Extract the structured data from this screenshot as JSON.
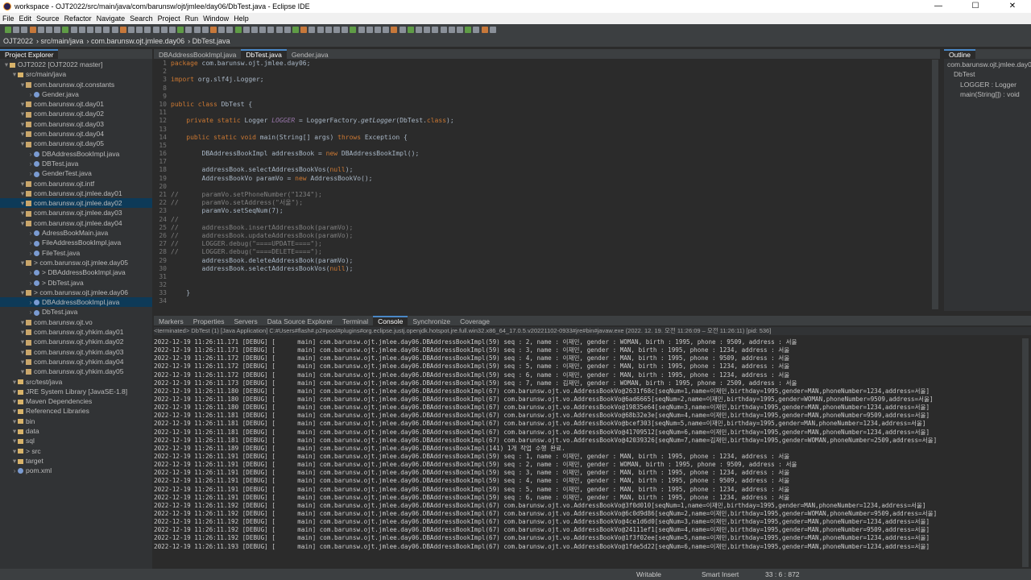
{
  "window": {
    "title": "workspace - OJT2022/src/main/java/com/barunsw/ojt/jmlee/day06/DbTest.java - Eclipse IDE",
    "min": "—",
    "max": "☐",
    "close": "✕"
  },
  "menu": [
    "File",
    "Edit",
    "Source",
    "Refactor",
    "Navigate",
    "Search",
    "Project",
    "Run",
    "Window",
    "Help"
  ],
  "breadcrumb": [
    "OJT2022",
    "src/main/java",
    "com.barunsw.ojt.jmlee.day06",
    "DbTest.java"
  ],
  "explorer": {
    "tab": "Project Explorer",
    "rows": [
      {
        "text": "OJT2022 [OJT2022 master]",
        "indent": 0,
        "kind": "proj"
      },
      {
        "text": "src/main/java",
        "indent": 1,
        "kind": "fd"
      },
      {
        "text": "com.barunsw.ojt.constants",
        "indent": 2,
        "kind": "pk"
      },
      {
        "text": "Gender.java",
        "indent": 3,
        "kind": "jf"
      },
      {
        "text": "com.barunsw.ojt.day01",
        "indent": 2,
        "kind": "pk"
      },
      {
        "text": "com.barunsw.ojt.day02",
        "indent": 2,
        "kind": "pk"
      },
      {
        "text": "com.barunsw.ojt.day03",
        "indent": 2,
        "kind": "pk"
      },
      {
        "text": "com.barunsw.ojt.day04",
        "indent": 2,
        "kind": "pk"
      },
      {
        "text": "com.barunsw.ojt.day05",
        "indent": 2,
        "kind": "pk"
      },
      {
        "text": "DBAddressBookImpl.java",
        "indent": 3,
        "kind": "jf"
      },
      {
        "text": "DBTest.java",
        "indent": 3,
        "kind": "jf"
      },
      {
        "text": "GenderTest.java",
        "indent": 3,
        "kind": "jf"
      },
      {
        "text": "com.barunsw.ojt.intf",
        "indent": 2,
        "kind": "pk"
      },
      {
        "text": "com.barunsw.ojt.jmlee.day01",
        "indent": 2,
        "kind": "pk"
      },
      {
        "text": "com.barunsw.ojt.jmlee.day02",
        "indent": 2,
        "kind": "pk",
        "sel": true
      },
      {
        "text": "com.barunsw.ojt.jmlee.day03",
        "indent": 2,
        "kind": "pk"
      },
      {
        "text": "com.barunsw.ojt.jmlee.day04",
        "indent": 2,
        "kind": "pk"
      },
      {
        "text": "AdressBookMain.java",
        "indent": 3,
        "kind": "jf"
      },
      {
        "text": "FileAddressBookImpl.java",
        "indent": 3,
        "kind": "jf"
      },
      {
        "text": "FileTest.java",
        "indent": 3,
        "kind": "jf"
      },
      {
        "text": "> com.barunsw.ojt.jmlee.day05",
        "indent": 2,
        "kind": "pk"
      },
      {
        "text": "> DBAddressBookImpl.java",
        "indent": 3,
        "kind": "jf"
      },
      {
        "text": "> DbTest.java",
        "indent": 3,
        "kind": "jf"
      },
      {
        "text": "> com.barunsw.ojt.jmlee.day06",
        "indent": 2,
        "kind": "pk"
      },
      {
        "text": "DBAddressBookImpl.java",
        "indent": 3,
        "kind": "jf",
        "sel": true
      },
      {
        "text": "DbTest.java",
        "indent": 3,
        "kind": "jf"
      },
      {
        "text": "com.barunsw.ojt.vo",
        "indent": 2,
        "kind": "pk"
      },
      {
        "text": "com.barunsw.ojt.yhkim.day01",
        "indent": 2,
        "kind": "pk"
      },
      {
        "text": "com.barunsw.ojt.yhkim.day02",
        "indent": 2,
        "kind": "pk"
      },
      {
        "text": "com.barunsw.ojt.yhkim.day03",
        "indent": 2,
        "kind": "pk"
      },
      {
        "text": "com.barunsw.ojt.yhkim.day04",
        "indent": 2,
        "kind": "pk"
      },
      {
        "text": "com.barunsw.ojt.yhkim.day05",
        "indent": 2,
        "kind": "pk"
      },
      {
        "text": "src/test/java",
        "indent": 1,
        "kind": "fd"
      },
      {
        "text": "JRE System Library [JavaSE-1.8]",
        "indent": 1,
        "kind": "fd"
      },
      {
        "text": "Maven Dependencies",
        "indent": 1,
        "kind": "fd"
      },
      {
        "text": "Referenced Libraries",
        "indent": 1,
        "kind": "fd"
      },
      {
        "text": "bin",
        "indent": 1,
        "kind": "fd"
      },
      {
        "text": "data",
        "indent": 1,
        "kind": "fd"
      },
      {
        "text": "sql",
        "indent": 1,
        "kind": "fd"
      },
      {
        "text": "> src",
        "indent": 1,
        "kind": "fd"
      },
      {
        "text": "target",
        "indent": 1,
        "kind": "fd"
      },
      {
        "text": "pom.xml",
        "indent": 1,
        "kind": "jf"
      }
    ]
  },
  "editor": {
    "tabs": [
      "DBAddressBookImpl.java",
      "DbTest.java",
      "Gender.java"
    ],
    "active_tab": 1,
    "lines": [
      {
        "n": "1",
        "html": "<span class=\"kw\">package</span> com.barunsw.ojt.jmlee.day06;"
      },
      {
        "n": "2",
        "html": ""
      },
      {
        "n": "3",
        "html": "<span class=\"kw\">import</span> org.slf4j.Logger;"
      },
      {
        "n": "8",
        "html": ""
      },
      {
        "n": "9",
        "html": ""
      },
      {
        "n": "10",
        "html": "<span class=\"kw\">public class</span> DbTest {"
      },
      {
        "n": "11",
        "html": ""
      },
      {
        "n": "12",
        "html": "    <span class=\"kw\">private static</span> Logger <span class=\"fld\">LOGGER</span> = LoggerFactory.<span class=\"it\">getLogger</span>(DbTest.<span class=\"kw\">class</span>);"
      },
      {
        "n": "13",
        "html": ""
      },
      {
        "n": "14",
        "html": "    <span class=\"kw\">public static void</span> main(String[] args) <span class=\"kw\">throws</span> Exception {"
      },
      {
        "n": "15",
        "html": ""
      },
      {
        "n": "16",
        "html": "        DBAddressBookImpl addressBook = <span class=\"kw\">new</span> DBAddressBookImpl();"
      },
      {
        "n": "17",
        "html": ""
      },
      {
        "n": "18",
        "html": "        addressBook.selectAddressBookVos(<span class=\"kw\">null</span>);"
      },
      {
        "n": "19",
        "html": "        AddressBookVo paramVo = <span class=\"kw\">new</span> AddressBookVo();"
      },
      {
        "n": "20",
        "html": ""
      },
      {
        "n": "21",
        "html": "<span class=\"cm\">//      paramVo.setPhoneNumber(\"1234\");</span>"
      },
      {
        "n": "22",
        "html": "<span class=\"cm\">//      paramVo.setAddress(\"서울\");</span>"
      },
      {
        "n": "23",
        "html": "        paramVo.setSeqNum(7);"
      },
      {
        "n": "24",
        "html": "<span class=\"cm\">//</span>"
      },
      {
        "n": "25",
        "html": "<span class=\"cm\">//      addressBook.insertAddressBook(paramVo);</span>"
      },
      {
        "n": "26",
        "html": "<span class=\"cm\">//      addressBook.updateAddressBook(paramVo);</span>"
      },
      {
        "n": "27",
        "html": "<span class=\"cm\">//      LOGGER.debug(\"====UPDATE====\");</span>"
      },
      {
        "n": "28",
        "html": "<span class=\"cm\">//      LOGGER.debug(\"====DELETE====\");</span>"
      },
      {
        "n": "29",
        "html": "        addressBook.deleteAddressBook(paramVo);"
      },
      {
        "n": "30",
        "html": "        addressBook.selectAddressBookVos(<span class=\"kw\">null</span>);"
      },
      {
        "n": "31",
        "html": ""
      },
      {
        "n": "32",
        "html": ""
      },
      {
        "n": "33",
        "html": "    }"
      },
      {
        "n": "34",
        "html": ""
      }
    ]
  },
  "outline": {
    "tab": "Outline",
    "rows": [
      "com.barunsw.ojt.jmlee.day06",
      "DbTest",
      "LOGGER : Logger",
      "main(String[]) : void"
    ]
  },
  "console": {
    "tabs": [
      "Markers",
      "Properties",
      "Servers",
      "Data Source Explorer",
      "Terminal",
      "Console",
      "Synchronize",
      "Coverage"
    ],
    "active_tab": 5,
    "header": "<terminated> DbTest (1) [Java Application] C:#Users#flash#.p2#pool#plugins#org.eclipse.justj.openjdk.hotspot.jre.full.win32.x86_64_17.0.5.v20221102-0933#jre#bin#javaw.exe  (2022. 12. 19. 오전 11:26:09 – 오전 11:26:11) [pid: 536]",
    "lines": [
      "2022-12-19 11:26:11.171 [DEBUG] [      main] com.barunsw.ojt.jmlee.day06.DBAddressBookImpl(59) seq : 2, name : 이재민, gender : WOMAN, birth : 1995, phone : 9509, address : 서울",
      "2022-12-19 11:26:11.171 [DEBUG] [      main] com.barunsw.ojt.jmlee.day06.DBAddressBookImpl(59) seq : 3, name : 이재민, gender : MAN, birth : 1995, phone : 1234, address : 서울",
      "2022-12-19 11:26:11.172 [DEBUG] [      main] com.barunsw.ojt.jmlee.day06.DBAddressBookImpl(59) seq : 4, name : 이재민, gender : MAN, birth : 1995, phone : 9509, address : 서울",
      "2022-12-19 11:26:11.172 [DEBUG] [      main] com.barunsw.ojt.jmlee.day06.DBAddressBookImpl(59) seq : 5, name : 이재민, gender : MAN, birth : 1995, phone : 1234, address : 서울",
      "2022-12-19 11:26:11.172 [DEBUG] [      main] com.barunsw.ojt.jmlee.day06.DBAddressBookImpl(59) seq : 6, name : 이재민, gender : MAN, birth : 1995, phone : 1234, address : 서울",
      "2022-12-19 11:26:11.173 [DEBUG] [      main] com.barunsw.ojt.jmlee.day06.DBAddressBookImpl(59) seq : 7, name : 김재민, gender : WOMAN, birth : 1995, phone : 2509, address : 서울",
      "2022-12-19 11:26:11.180 [DEBUG] [      main] com.barunsw.ojt.jmlee.day06.DBAddressBookImpl(67) com.barunsw.ojt.vo.AddressBookVo@2631f68c[seqNum=1,name=이재민,birthday=1995,gender=MAN,phoneNumber=1234,address=서울]",
      "2022-12-19 11:26:11.180 [DEBUG] [      main] com.barunsw.ojt.jmlee.day06.DBAddressBookImpl(67) com.barunsw.ojt.vo.AddressBookVo@6ad6665[seqNum=2,name=이재민,birthday=1995,gender=WOMAN,phoneNumber=9509,address=서울]",
      "2022-12-19 11:26:11.180 [DEBUG] [      main] com.barunsw.ojt.jmlee.day06.DBAddressBookImpl(67) com.barunsw.ojt.vo.AddressBookVo@19835e64[seqNum=3,name=이재민,birthday=1995,gender=MAN,phoneNumber=1234,address=서울]",
      "2022-12-19 11:26:11.181 [DEBUG] [      main] com.barunsw.ojt.jmlee.day06.DBAddressBookImpl(67) com.barunsw.ojt.vo.AddressBookVo@68b32e3e[seqNum=4,name=이재민,birthday=1995,gender=MAN,phoneNumber=9509,address=서울]",
      "2022-12-19 11:26:11.181 [DEBUG] [      main] com.barunsw.ojt.jmlee.day06.DBAddressBookImpl(67) com.barunsw.ojt.vo.AddressBookVo@bcef303[seqNum=5,name=이재민,birthday=1995,gender=MAN,phoneNumber=1234,address=서울]",
      "2022-12-19 11:26:11.181 [DEBUG] [      main] com.barunsw.ojt.jmlee.day06.DBAddressBookImpl(67) com.barunsw.ojt.vo.AddressBookVo@41709512[seqNum=6,name=이재민,birthday=1995,gender=MAN,phoneNumber=1234,address=서울]",
      "2022-12-19 11:26:11.181 [DEBUG] [      main] com.barunsw.ojt.jmlee.day06.DBAddressBookImpl(67) com.barunsw.ojt.vo.AddressBookVo@42039326[seqNum=7,name=김재민,birthday=1995,gender=WOMAN,phoneNumber=2509,address=서울]",
      "2022-12-19 11:26:11.189 [DEBUG] [      main] com.barunsw.ojt.jmlee.day06.DBAddressBookImpl(141) 1개 작업 수행 완료.",
      "2022-12-19 11:26:11.191 [DEBUG] [      main] com.barunsw.ojt.jmlee.day06.DBAddressBookImpl(59) seq : 1, name : 이재민, gender : MAN, birth : 1995, phone : 1234, address : 서울",
      "2022-12-19 11:26:11.191 [DEBUG] [      main] com.barunsw.ojt.jmlee.day06.DBAddressBookImpl(59) seq : 2, name : 이재민, gender : WOMAN, birth : 1995, phone : 9509, address : 서울",
      "2022-12-19 11:26:11.191 [DEBUG] [      main] com.barunsw.ojt.jmlee.day06.DBAddressBookImpl(59) seq : 3, name : 이재민, gender : MAN, birth : 1995, phone : 1234, address : 서울",
      "2022-12-19 11:26:11.191 [DEBUG] [      main] com.barunsw.ojt.jmlee.day06.DBAddressBookImpl(59) seq : 4, name : 이재민, gender : MAN, birth : 1995, phone : 9509, address : 서울",
      "2022-12-19 11:26:11.191 [DEBUG] [      main] com.barunsw.ojt.jmlee.day06.DBAddressBookImpl(59) seq : 5, name : 이재민, gender : MAN, birth : 1995, phone : 1234, address : 서울",
      "2022-12-19 11:26:11.191 [DEBUG] [      main] com.barunsw.ojt.jmlee.day06.DBAddressBookImpl(59) seq : 6, name : 이재민, gender : MAN, birth : 1995, phone : 1234, address : 서울",
      "2022-12-19 11:26:11.192 [DEBUG] [      main] com.barunsw.ojt.jmlee.day06.DBAddressBookImpl(67) com.barunsw.ojt.vo.AddressBookVo@3f0d010[seqNum=1,name=이재민,birthday=1995,gender=MAN,phoneNumber=1234,address=서울]",
      "2022-12-19 11:26:11.192 [DEBUG] [      main] com.barunsw.ojt.jmlee.day06.DBAddressBookImpl(67) com.barunsw.ojt.vo.AddressBookVo@6c0d9d86[seqNum=2,name=이재민,birthday=1995,gender=WOMAN,phoneNumber=9509,address=서울]",
      "2022-12-19 11:26:11.192 [DEBUG] [      main] com.barunsw.ojt.jmlee.day06.DBAddressBookImpl(67) com.barunsw.ojt.vo.AddressBookVo@4ce1d6d0[seqNum=3,name=이재민,birthday=1995,gender=MAN,phoneNumber=1234,address=서울]",
      "2022-12-19 11:26:11.192 [DEBUG] [      main] com.barunsw.ojt.jmlee.day06.DBAddressBookImpl(67) com.barunsw.ojt.vo.AddressBookVo@24111ef1[seqNum=4,name=이재민,birthday=1995,gender=MAN,phoneNumber=9509,address=서울]",
      "2022-12-19 11:26:11.192 [DEBUG] [      main] com.barunsw.ojt.jmlee.day06.DBAddressBookImpl(67) com.barunsw.ojt.vo.AddressBookVo@1f3f02ee[seqNum=5,name=이재민,birthday=1995,gender=MAN,phoneNumber=1234,address=서울]",
      "2022-12-19 11:26:11.193 [DEBUG] [      main] com.barunsw.ojt.jmlee.day06.DBAddressBookImpl(67) com.barunsw.ojt.vo.AddressBookVo@1fde5d22[seqNum=6,name=이재민,birthday=1995,gender=MAN,phoneNumber=1234,address=서울]"
    ]
  },
  "status": {
    "mode": "Writable",
    "insert": "Smart Insert",
    "position": "33 : 6 : 872"
  }
}
